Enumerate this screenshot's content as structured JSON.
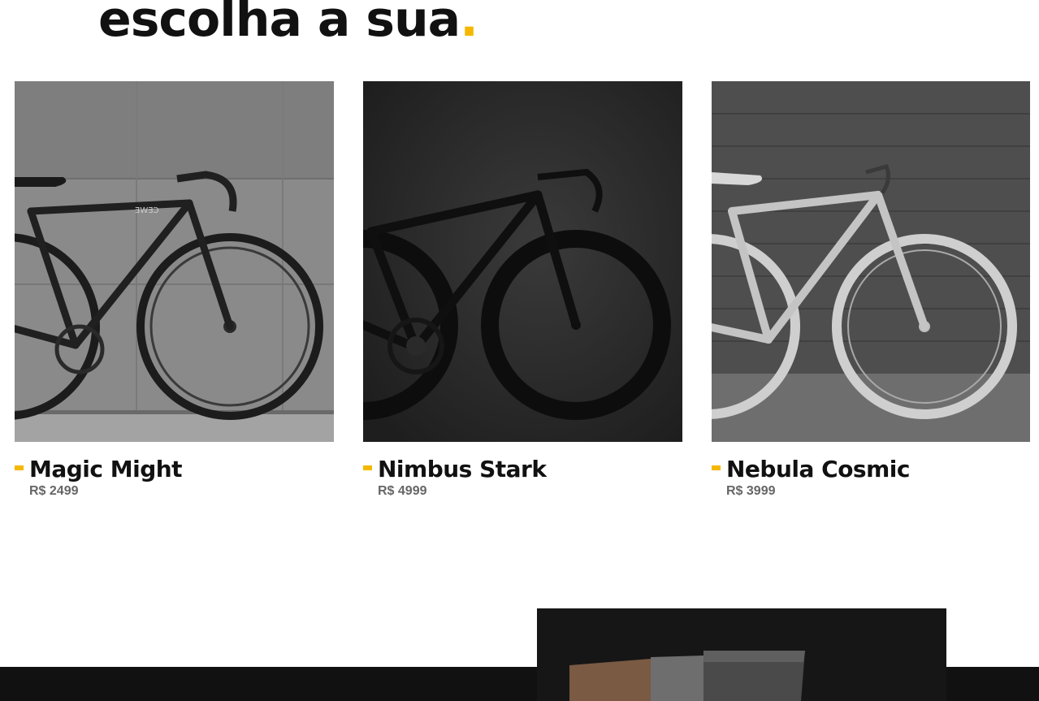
{
  "hero": {
    "title": "escolha a sua",
    "dot": "."
  },
  "products": [
    {
      "name": "Magic Might",
      "price": "R$ 2499",
      "frame_brand": "ƎWƎↃ"
    },
    {
      "name": "Nimbus Stark",
      "price": "R$ 4999"
    },
    {
      "name": "Nebula Cosmic",
      "price": "R$ 3999"
    }
  ],
  "colors": {
    "accent": "#f5b800",
    "text": "#111111",
    "muted": "#666666",
    "band": "#111111"
  }
}
